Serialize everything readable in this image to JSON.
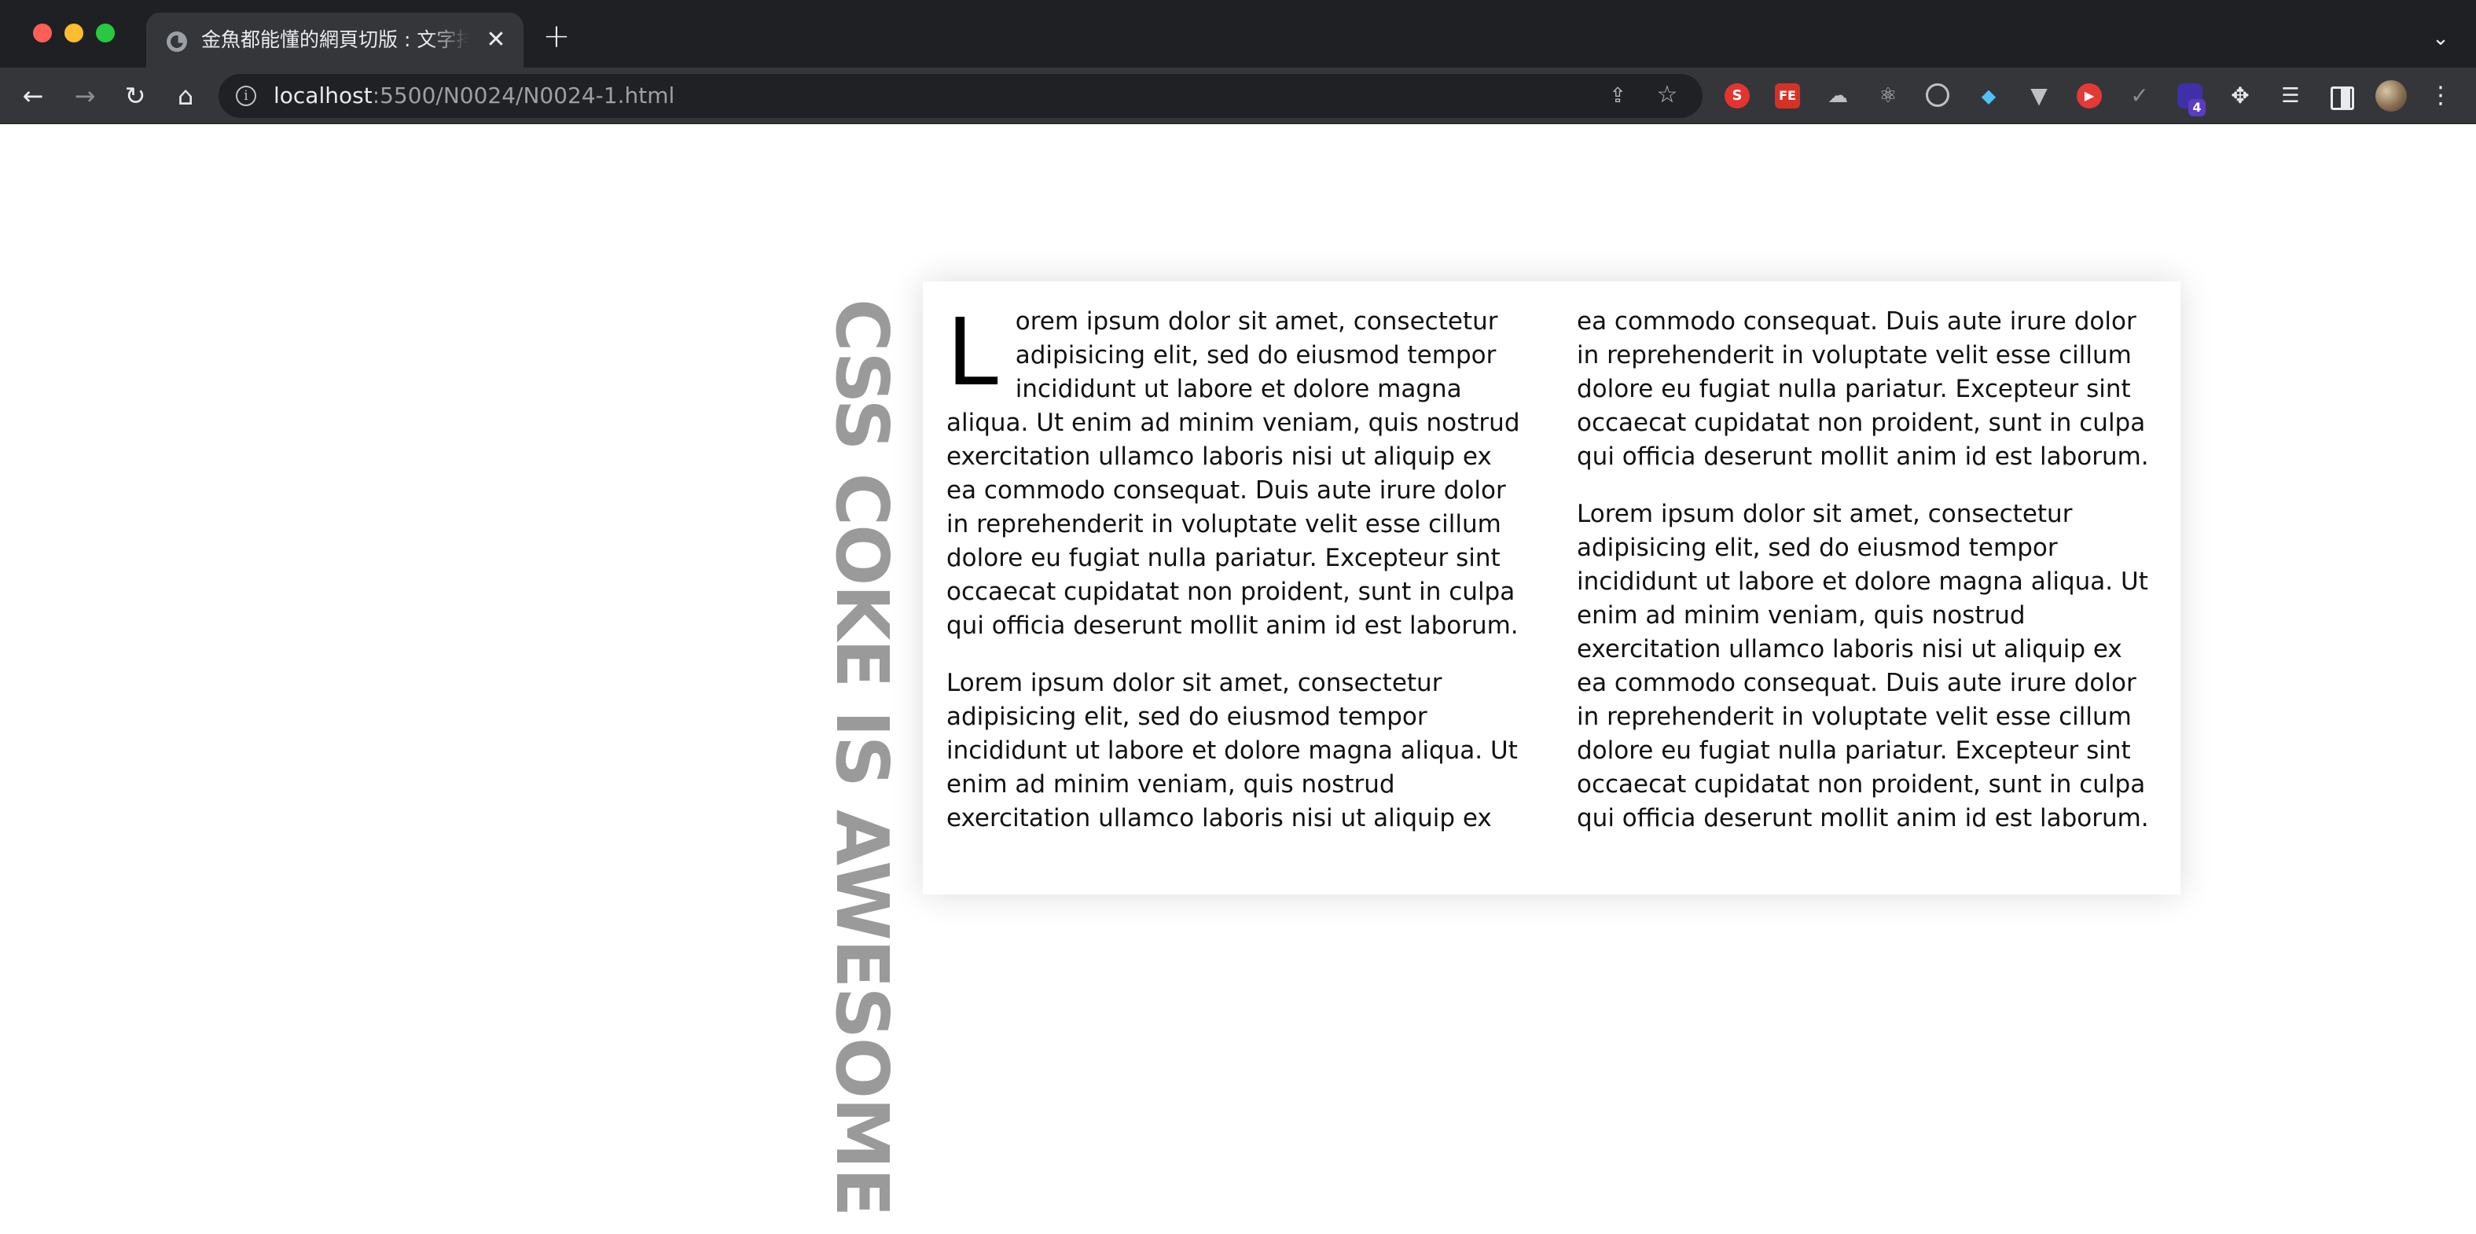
{
  "browser": {
    "tab": {
      "title": "金魚都能懂的網頁切版 : 文字排版"
    },
    "new_tab_label": "+",
    "tab_menu_label": "⌄",
    "url": {
      "host": "localhost",
      "path": ":5500/N0024/N0024-1.html"
    },
    "extensions": [
      {
        "icon": "s-extension-icon",
        "label": "S"
      },
      {
        "icon": "fe-extension-icon",
        "label": "FE"
      },
      {
        "icon": "cloud-extension-icon"
      },
      {
        "icon": "react-extension-icon"
      },
      {
        "icon": "target-extension-icon"
      },
      {
        "icon": "gem-extension-icon"
      },
      {
        "icon": "vue-extension-icon"
      },
      {
        "icon": "youtube-extension-icon"
      },
      {
        "icon": "check-extension-icon"
      },
      {
        "icon": "stack-extension-icon",
        "badge": "4"
      },
      {
        "icon": "puzzle-extensions-icon"
      },
      {
        "icon": "reading-list-icon"
      },
      {
        "icon": "side-panel-icon"
      }
    ]
  },
  "page": {
    "vertical_title": "CSS COKE IS AWESOME",
    "dropcap": "L",
    "paragraphs": [
      "orem ipsum dolor sit amet, consectetur adipisicing elit, sed do eiusmod tempor incididunt ut labore et dolore magna aliqua. Ut enim ad minim veniam, quis nostrud exercitation ullamco laboris nisi ut aliquip ex ea commodo consequat. Duis aute irure dolor in reprehenderit in voluptate velit esse cillum dolore eu fugiat nulla pariatur. Excepteur sint occaecat cupidatat non proident, sunt in culpa qui officia deserunt mollit anim id est laborum.",
      "Lorem ipsum dolor sit amet, consectetur adipisicing elit, sed do eiusmod tempor incididunt ut labore et dolore magna aliqua. Ut enim ad minim veniam, quis nostrud exercitation ullamco laboris nisi ut aliquip ex ea commodo consequat. Duis aute irure dolor in reprehenderit in voluptate velit esse cillum dolore eu fugiat nulla pariatur. Excepteur sint occaecat cupidatat non proident, sunt in culpa qui officia deserunt mollit anim id est laborum.",
      "Lorem ipsum dolor sit amet, consectetur adipisicing elit, sed do eiusmod tempor incididunt ut labore et dolore magna aliqua. Ut enim ad minim veniam, quis nostrud exercitation ullamco laboris nisi ut aliquip ex ea commodo consequat. Duis aute irure dolor in reprehenderit in voluptate velit esse cillum dolore eu fugiat nulla pariatur. Excepteur sint occaecat cupidatat non proident, sunt in culpa qui officia deserunt mollit anim id est laborum."
    ]
  },
  "colors": {
    "chrome_dark": "#1f2023",
    "toolbar": "#35363a",
    "vertical_title": "#9a9a9a",
    "body_text": "#111111"
  }
}
